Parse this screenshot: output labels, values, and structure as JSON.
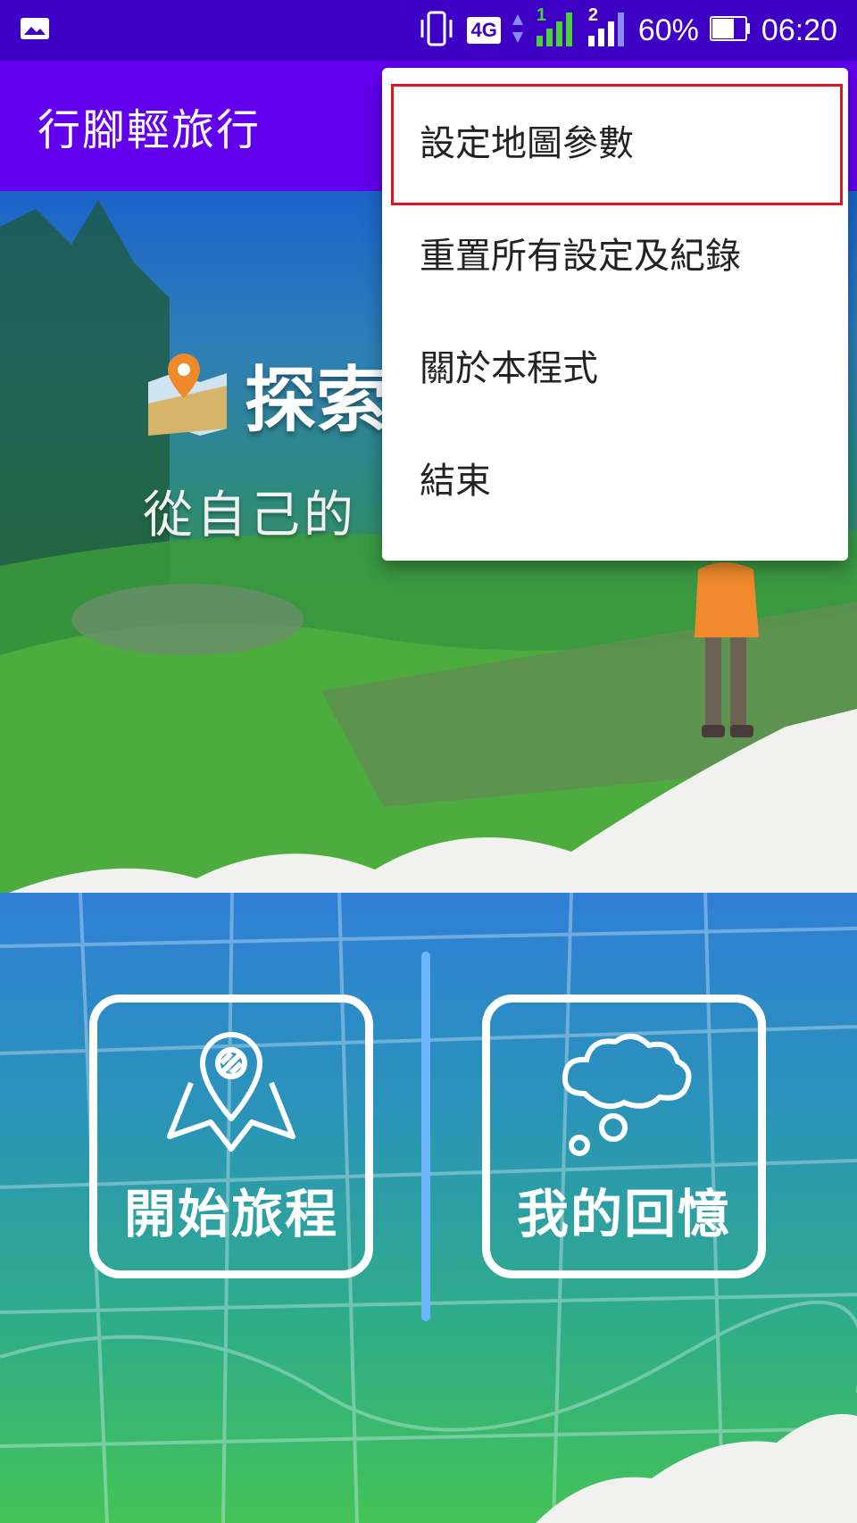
{
  "status_bar": {
    "network_label": "4G",
    "sim1_label": "1",
    "sim2_label": "2",
    "battery_percent": "60%",
    "time": "06:20"
  },
  "app_bar": {
    "title": "行腳輕旅行"
  },
  "hero": {
    "headline": "探索",
    "subtitle": "從自己的"
  },
  "tiles": {
    "start_label": "開始旅程",
    "memory_label": "我的回憶"
  },
  "menu": {
    "items": [
      {
        "label": "設定地圖參數"
      },
      {
        "label": "重置所有設定及紀錄"
      },
      {
        "label": "關於本程式"
      },
      {
        "label": "結束"
      }
    ]
  },
  "colors": {
    "status_bar": "#3d00c4",
    "app_bar": "#6200ee",
    "highlight_border": "#e0141e"
  }
}
